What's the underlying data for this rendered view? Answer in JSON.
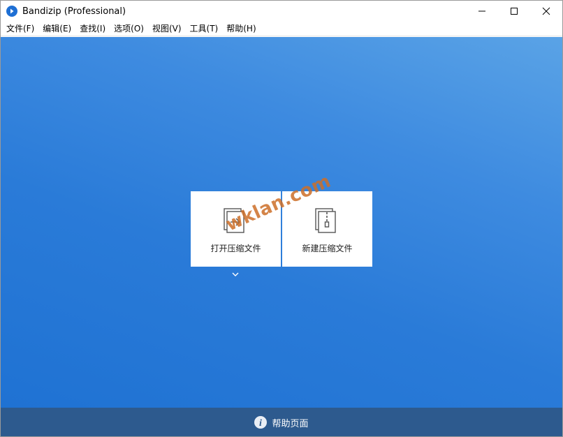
{
  "window": {
    "title": "Bandizip (Professional)"
  },
  "menu": {
    "items": [
      "文件(F)",
      "编辑(E)",
      "查找(I)",
      "选项(O)",
      "视图(V)",
      "工具(T)",
      "帮助(H)"
    ]
  },
  "main": {
    "open_archive_label": "打开压缩文件",
    "new_archive_label": "新建压缩文件",
    "watermark": "wklan.com"
  },
  "footer": {
    "help_label": "帮助页面"
  },
  "colors": {
    "accent": "#1e6fd4",
    "main_background": "#2a7bd8",
    "footer_background": "#2d5a8e"
  }
}
